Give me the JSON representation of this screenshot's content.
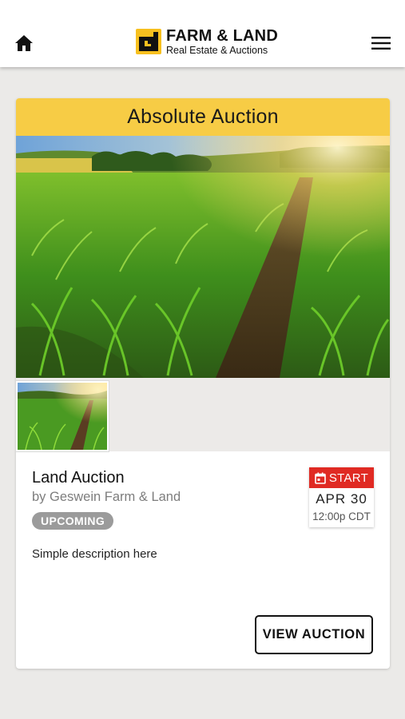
{
  "header": {
    "brand_name": "FARM & LAND",
    "brand_sub": "Real Estate & Auctions",
    "brand_accent": "#f7c01f",
    "home_icon": "home-icon",
    "menu_icon": "hamburger-menu-icon"
  },
  "card": {
    "banner_label": "Absolute Auction",
    "banner_color": "#f7cc45",
    "title": "Land Auction",
    "byline": "by Geswein Farm & Land",
    "status": "UPCOMING",
    "description": "Simple description here",
    "start": {
      "label": "START",
      "date": "APR 30",
      "time": "12:00p CDT",
      "color": "#e02a23",
      "icon": "calendar-icon"
    },
    "view_button": "VIEW AUCTION"
  }
}
